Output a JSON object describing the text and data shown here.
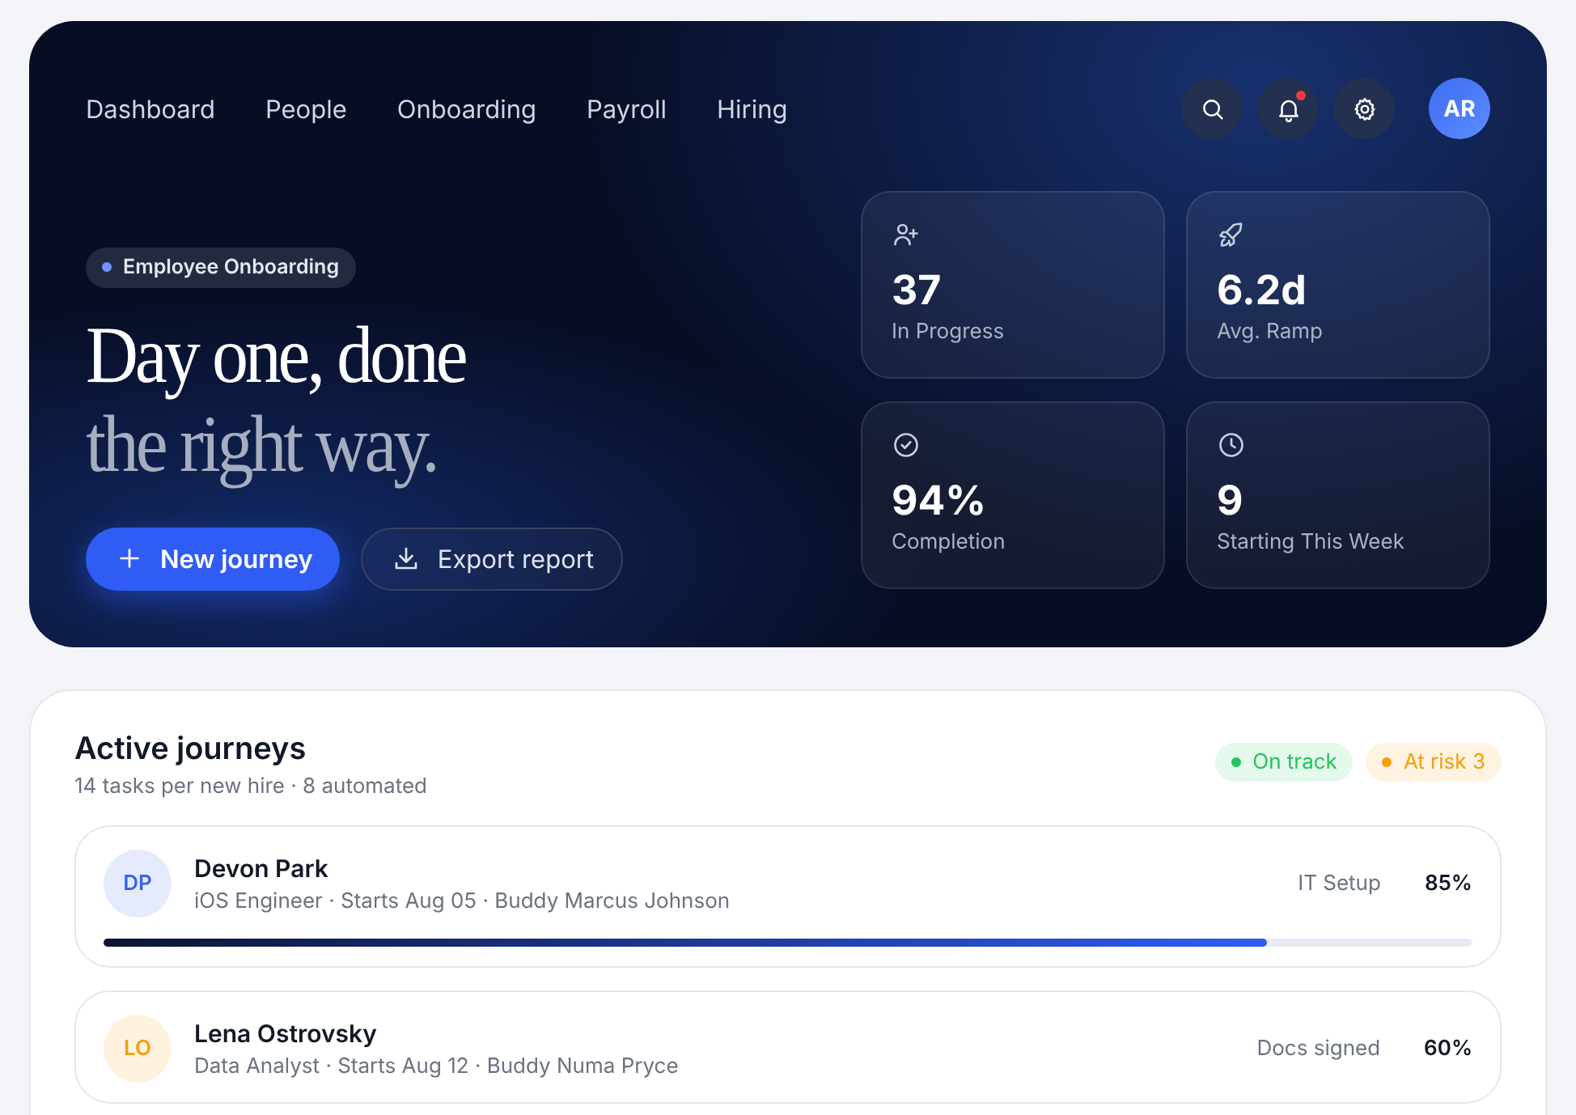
{
  "nav": {
    "items": [
      {
        "label": "Dashboard"
      },
      {
        "label": "People"
      },
      {
        "label": "Onboarding"
      },
      {
        "label": "Payroll"
      },
      {
        "label": "Hiring"
      }
    ]
  },
  "header_actions": {
    "notification_unread": true,
    "avatar": "AR"
  },
  "hero": {
    "badge": "Employee Onboarding",
    "title_line_1": "Day one, done",
    "title_line_2": "the right way.",
    "buttons": [
      {
        "kind": "primary",
        "label": "New journey"
      },
      {
        "kind": "secondary",
        "label": "Export report"
      }
    ]
  },
  "stats": [
    {
      "value": "37",
      "label": "In Progress"
    },
    {
      "value": "6.2d",
      "label": "Avg. Ramp"
    },
    {
      "value": "94%",
      "label": "Completion"
    },
    {
      "value": "9",
      "label": "Starting This Week"
    }
  ],
  "journeys": {
    "title": "Active journeys",
    "subtitle": "14 tasks per new hire · 8 automated",
    "statuses": [
      {
        "label": "On track",
        "color": "#22c55e"
      },
      {
        "label": "At risk 3",
        "color": "#f59e0b"
      }
    ],
    "rows": [
      {
        "initials": "DP",
        "color": "#3b63f0",
        "name": "Devon Park",
        "details": "iOS Engineer · Starts Aug 05 · Buddy Marcus Johnson",
        "stage": "IT Setup",
        "percent": "85%",
        "level": 0.85
      },
      {
        "initials": "LO",
        "color": "#f59e0b",
        "name": "Lena Ostrovsky",
        "details": "Data Analyst · Starts Aug 12 · Buddy Numa Pryce",
        "stage": "Docs signed",
        "percent": "60%"
      }
    ]
  }
}
